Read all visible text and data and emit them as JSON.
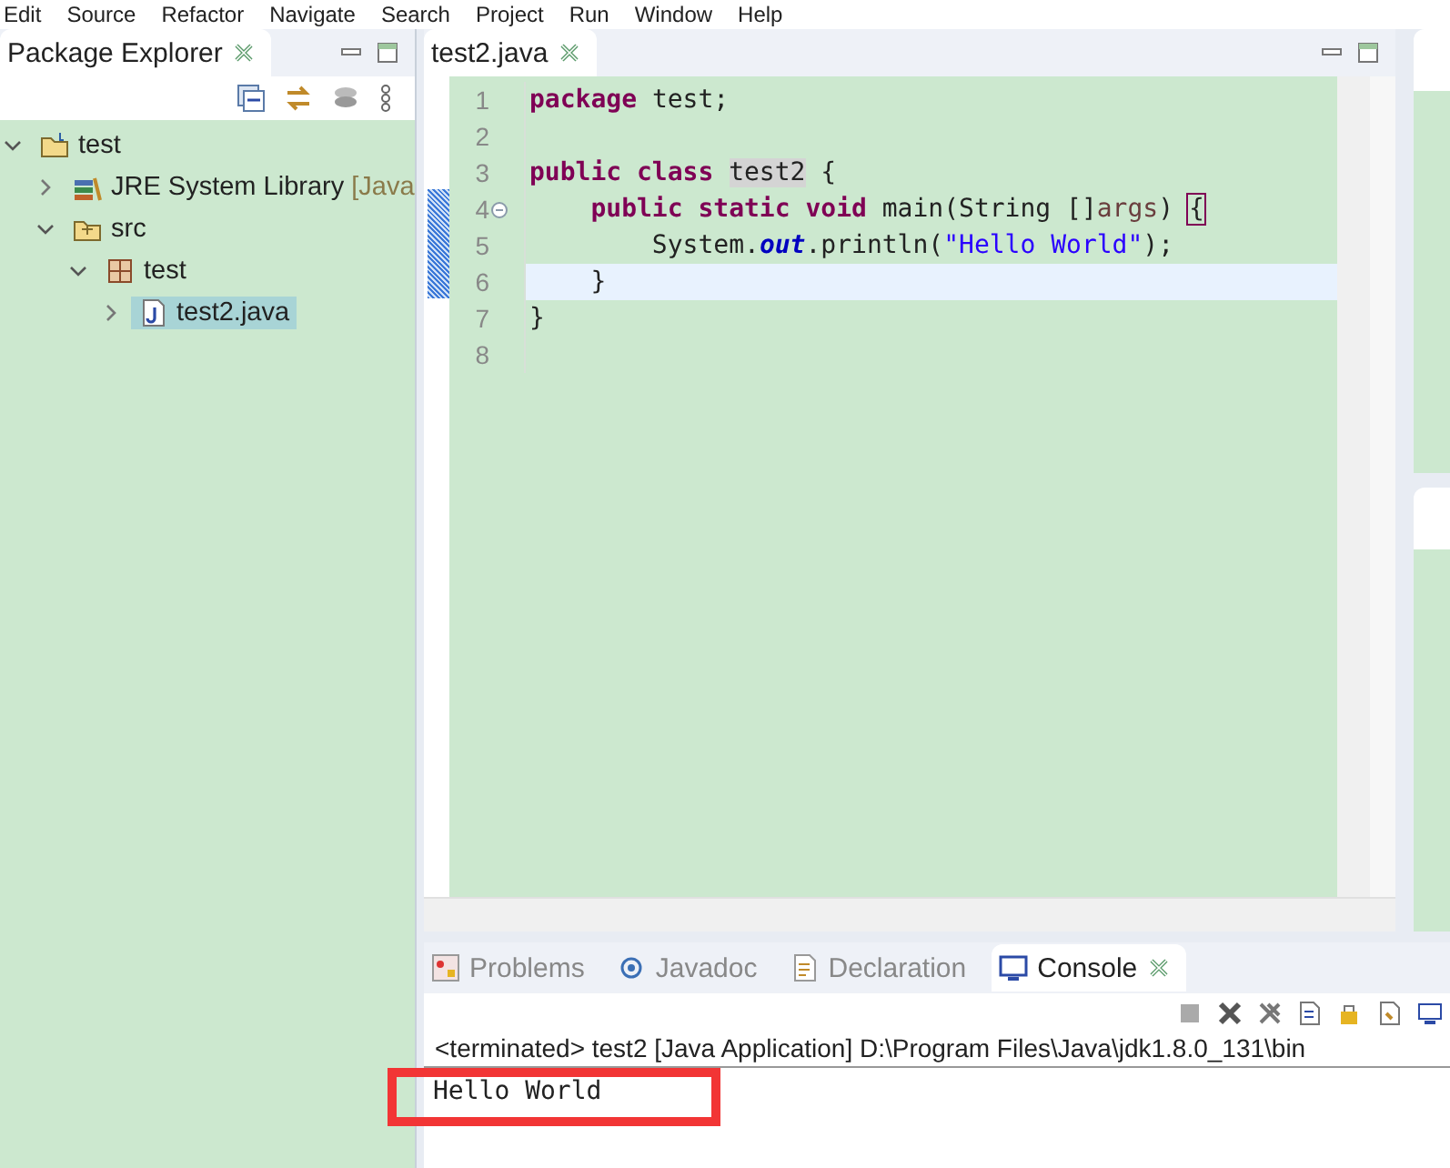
{
  "menu": [
    "Edit",
    "Source",
    "Refactor",
    "Navigate",
    "Search",
    "Project",
    "Run",
    "Window",
    "Help"
  ],
  "explorer": {
    "tab": {
      "label": "Package Explorer",
      "selected": true
    },
    "tree": [
      {
        "label": "test",
        "kind": "project",
        "expanded": true,
        "selected": false,
        "children": [
          {
            "label": "JRE System Library",
            "decoration": "[Java",
            "kind": "library",
            "expanded": false,
            "selected": false
          },
          {
            "label": "src",
            "kind": "folder",
            "expanded": true,
            "selected": false,
            "children": [
              {
                "label": "test",
                "kind": "package",
                "expanded": true,
                "selected": false,
                "children": [
                  {
                    "label": "test2.java",
                    "kind": "java",
                    "expanded": false,
                    "selected": true
                  }
                ]
              }
            ]
          }
        ]
      }
    ]
  },
  "editor": {
    "tabs": [
      {
        "label": "test2.java",
        "selected": true
      }
    ],
    "lines": [
      {
        "number": "1",
        "current": false,
        "segments": [
          {
            "kind": "keyword",
            "text": "package"
          },
          {
            "kind": "plain",
            "text": " test;"
          }
        ]
      },
      {
        "number": "2",
        "current": false
      },
      {
        "number": "3",
        "current": false,
        "segments": [
          {
            "kind": "keyword",
            "text": "public class "
          },
          {
            "kind": "occurrence",
            "text": "test2"
          },
          {
            "kind": "plain",
            "text": " {"
          }
        ]
      },
      {
        "number": "4",
        "current": false,
        "folding": true,
        "segments": [
          {
            "kind": "keyword",
            "text": "    public static void"
          },
          {
            "kind": "plain",
            "text": " main(String []"
          },
          {
            "kind": "param",
            "text": "args"
          },
          {
            "kind": "plain",
            "text": ") "
          },
          {
            "kind": "bracket",
            "text": "{"
          }
        ]
      },
      {
        "number": "5",
        "current": false,
        "segments": [
          {
            "kind": "plain",
            "text": "        System."
          },
          {
            "kind": "field",
            "text": "out"
          },
          {
            "kind": "plain",
            "text": ".println("
          },
          {
            "kind": "string",
            "text": "\"Hello World\""
          },
          {
            "kind": "plain",
            "text": ");"
          }
        ]
      },
      {
        "number": "6",
        "current": true,
        "segments": [
          {
            "kind": "plain",
            "text": "    }"
          }
        ]
      },
      {
        "number": "7",
        "current": false,
        "segments": [
          {
            "kind": "plain",
            "text": "}"
          }
        ]
      },
      {
        "number": "8",
        "current": false
      }
    ]
  },
  "console": {
    "tabs": [
      {
        "label": "Problems",
        "kind": "problems",
        "selected": false
      },
      {
        "label": "Javadoc",
        "kind": "at",
        "selected": false
      },
      {
        "label": "Declaration",
        "kind": "declaration",
        "selected": false
      },
      {
        "label": "Console",
        "kind": "console",
        "selected": true
      }
    ],
    "header": "<terminated> test2 [Java Application] D:\\Program Files\\Java\\jdk1.8.0_131\\bin",
    "output": [
      "Hello World"
    ]
  }
}
